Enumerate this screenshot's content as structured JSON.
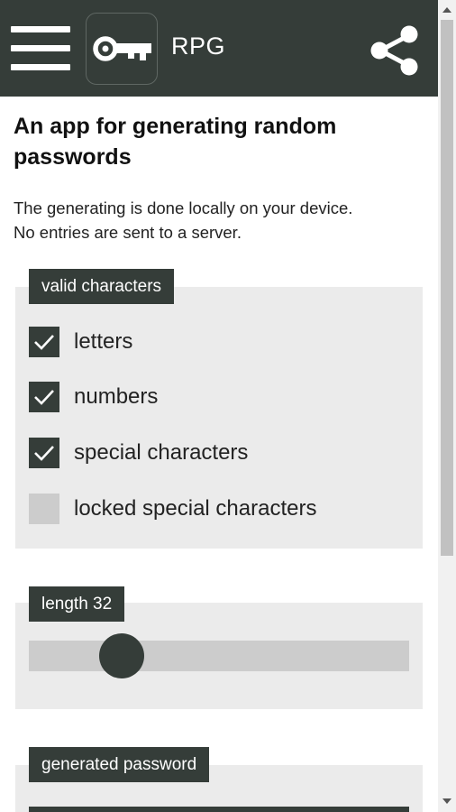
{
  "header": {
    "app_name": "RPG",
    "icons": {
      "menu": "hamburger-menu-icon",
      "logo": "key-icon",
      "share": "share-icon"
    },
    "colors": {
      "bar": "#353d39",
      "text": "#ffffff"
    }
  },
  "intro": {
    "headline": "An app for generating random passwords",
    "description_lines": [
      "The generating is done locally on your device.",
      "No entries are sent to a server."
    ]
  },
  "valid_characters": {
    "title": "valid characters",
    "options": [
      {
        "label": "letters",
        "checked": true
      },
      {
        "label": "numbers",
        "checked": true
      },
      {
        "label": "special characters",
        "checked": true
      },
      {
        "label": "locked special characters",
        "checked": false
      }
    ]
  },
  "length": {
    "title": "length 32",
    "value": 32,
    "slider_fraction": 0.21
  },
  "generated": {
    "title": "generated password"
  },
  "colors": {
    "accent": "#353d39",
    "panel_bg": "#ebebeb",
    "unchecked_box": "#cccccc"
  }
}
